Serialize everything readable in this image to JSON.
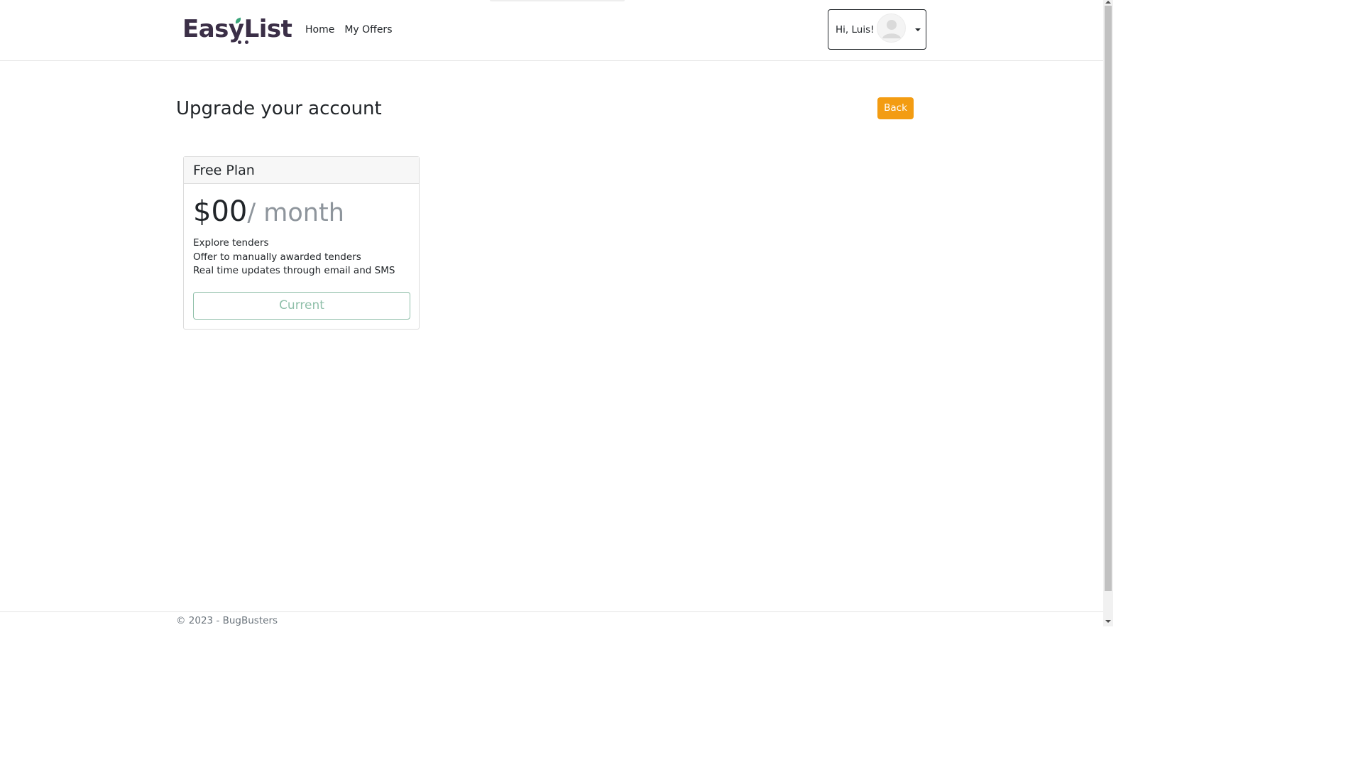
{
  "header": {
    "logo_text": "EasyList",
    "nav": [
      {
        "label": "Home"
      },
      {
        "label": "My Offers"
      }
    ],
    "user_menu": {
      "greeting": "Hi, Luis!",
      "avatar_icon": "user-avatar-icon",
      "dropdown_icon": "caret-down-icon"
    }
  },
  "main": {
    "title": "Upgrade your account",
    "back_label": "Back",
    "plans": [
      {
        "name": "Free Plan",
        "price": "$00",
        "period": "/ month",
        "features": [
          "Explore tenders",
          "Offer to manually awarded tenders",
          "Real time updates through email and SMS"
        ],
        "action_label": "Current"
      }
    ]
  },
  "footer": {
    "text": "© 2023 - BugBusters"
  },
  "colors": {
    "brand_dark": "#3b2f47",
    "brand_leaf": "#3aa57a",
    "back_button": "#f39c12",
    "current_button": "#8fbfa9"
  }
}
